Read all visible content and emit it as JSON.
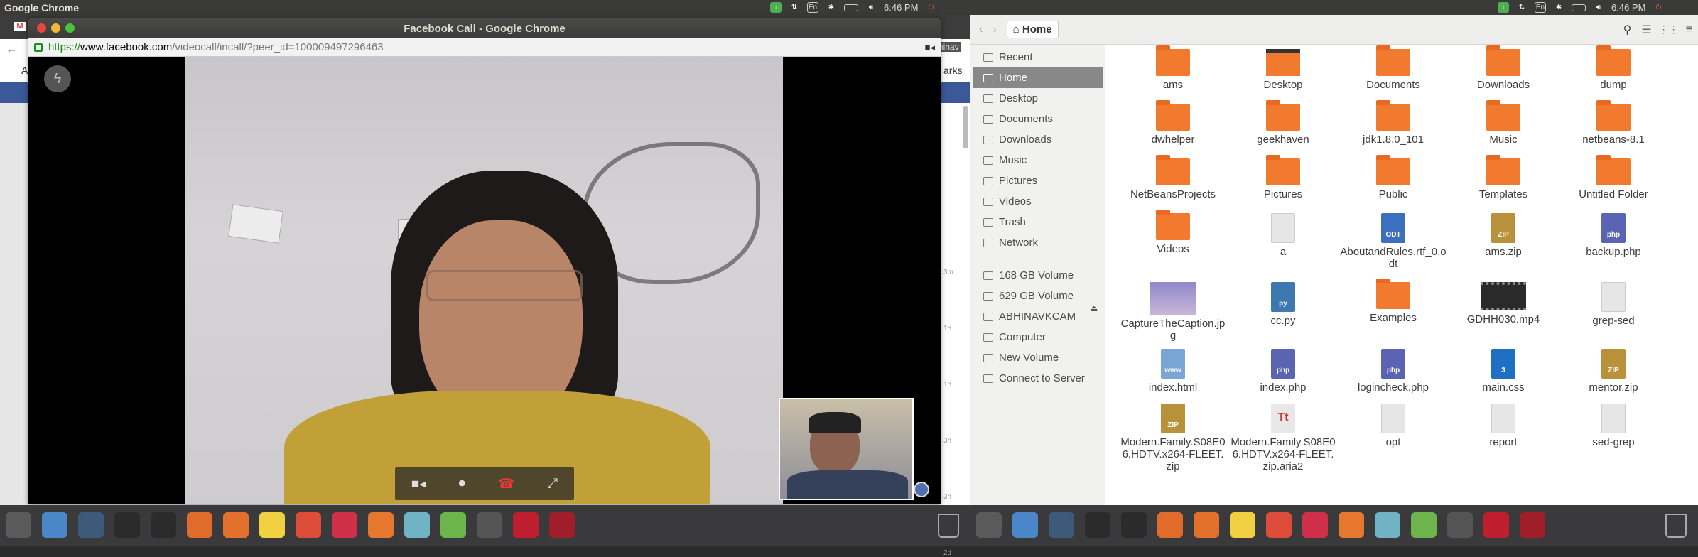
{
  "left_panel": {
    "app_title": "Google Chrome",
    "time": "6:46 PM",
    "lang": "En"
  },
  "right_panel": {
    "time": "6:46 PM",
    "lang": "En"
  },
  "chrome": {
    "window_title": "Facebook Call - Google Chrome",
    "url_scheme": "https://",
    "url_host": "www.facebook.com",
    "url_path": "/videocall/incall/?peer_id=100009497296463",
    "bg_tab_letter": "A",
    "bg_bookmarks": "arks",
    "bg_user": "hinav"
  },
  "call": {
    "controls": [
      "video-camera",
      "microphone",
      "end-call",
      "fullscreen"
    ],
    "timestamps": [
      "3m",
      "1h",
      "1h",
      "3h",
      "3h",
      "2d"
    ]
  },
  "files": {
    "location": "Home",
    "sidebar": [
      {
        "label": "Recent"
      },
      {
        "label": "Home",
        "selected": true
      },
      {
        "label": "Desktop"
      },
      {
        "label": "Documents"
      },
      {
        "label": "Downloads"
      },
      {
        "label": "Music"
      },
      {
        "label": "Pictures"
      },
      {
        "label": "Videos"
      },
      {
        "label": "Trash"
      },
      {
        "label": "Network"
      }
    ],
    "devices": [
      {
        "label": "168 GB Volume"
      },
      {
        "label": "629 GB Volume"
      },
      {
        "label": "ABHINAVKCAM"
      },
      {
        "label": "Computer"
      },
      {
        "label": "New Volume"
      },
      {
        "label": "Connect to Server"
      }
    ],
    "items": [
      {
        "name": "ams",
        "kind": "folder"
      },
      {
        "name": "Desktop",
        "kind": "desktop"
      },
      {
        "name": "Documents",
        "kind": "folder"
      },
      {
        "name": "Downloads",
        "kind": "folder"
      },
      {
        "name": "dump",
        "kind": "folder"
      },
      {
        "name": "dwhelper",
        "kind": "folder"
      },
      {
        "name": "geekhaven",
        "kind": "folder"
      },
      {
        "name": "jdk1.8.0_101",
        "kind": "folder"
      },
      {
        "name": "Music",
        "kind": "folder"
      },
      {
        "name": "netbeans-8.1",
        "kind": "folder"
      },
      {
        "name": "NetBeansProjects",
        "kind": "folder"
      },
      {
        "name": "Pictures",
        "kind": "folder"
      },
      {
        "name": "Public",
        "kind": "folder"
      },
      {
        "name": "Templates",
        "kind": "folder"
      },
      {
        "name": "Untitled Folder",
        "kind": "folder"
      },
      {
        "name": "Videos",
        "kind": "folder"
      },
      {
        "name": "a",
        "kind": "blank"
      },
      {
        "name": "AboutandRules.rtf_0.odt",
        "kind": "odt"
      },
      {
        "name": "ams.zip",
        "kind": "zip"
      },
      {
        "name": "backup.php",
        "kind": "php"
      },
      {
        "name": "CaptureTheCaption.jpg",
        "kind": "image"
      },
      {
        "name": "cc.py",
        "kind": "py"
      },
      {
        "name": "Examples",
        "kind": "folder"
      },
      {
        "name": "GDHH030.mp4",
        "kind": "video"
      },
      {
        "name": "grep-sed",
        "kind": "blank"
      },
      {
        "name": "index.html",
        "kind": "html"
      },
      {
        "name": "index.php",
        "kind": "php"
      },
      {
        "name": "logincheck.php",
        "kind": "php"
      },
      {
        "name": "main.css",
        "kind": "css"
      },
      {
        "name": "mentor.zip",
        "kind": "zip"
      },
      {
        "name": "Modern.Family.S08E06.HDTV.x264-FLEET.zip",
        "kind": "zip"
      },
      {
        "name": "Modern.Family.S08E06.HDTV.x264-FLEET.zip.aria2",
        "kind": "font"
      },
      {
        "name": "opt",
        "kind": "blank"
      },
      {
        "name": "report",
        "kind": "blank"
      },
      {
        "name": "sed-grep",
        "kind": "blank"
      }
    ]
  },
  "doc_labels": {
    "odt": "ODT",
    "zip": "ZIP",
    "php": "php",
    "py": "py",
    "css": "3",
    "html": "www",
    "font": "Tt"
  },
  "dock": [
    {
      "icon": "settings-icon",
      "color": "#5a5a5a"
    },
    {
      "icon": "cube-icon",
      "color": "#4a86c8"
    },
    {
      "icon": "s-app-icon",
      "color": "#3d5a7a"
    },
    {
      "icon": "terminal-icon",
      "color": "#2b2b2b"
    },
    {
      "icon": "terminal-icon",
      "color": "#2b2b2b"
    },
    {
      "icon": "home-folder-icon",
      "color": "#e06b2a"
    },
    {
      "icon": "store-icon",
      "color": "#e36f2c"
    },
    {
      "icon": "text-editor-icon",
      "color": "#f0d040"
    },
    {
      "icon": "chrome-icon",
      "color": "#dd4b39"
    },
    {
      "icon": "mixer-icon",
      "color": "#d02f4a"
    },
    {
      "icon": "firefox-icon",
      "color": "#e6772e"
    },
    {
      "icon": "tool-icon",
      "color": "#6fb3c4"
    },
    {
      "icon": "update-icon",
      "color": "#6cb44c"
    },
    {
      "icon": "webcam-icon",
      "color": "#555"
    },
    {
      "icon": "filezilla-icon",
      "color": "#bf1e2e"
    },
    {
      "icon": "sd-card-icon",
      "color": "#a01d2a"
    }
  ]
}
